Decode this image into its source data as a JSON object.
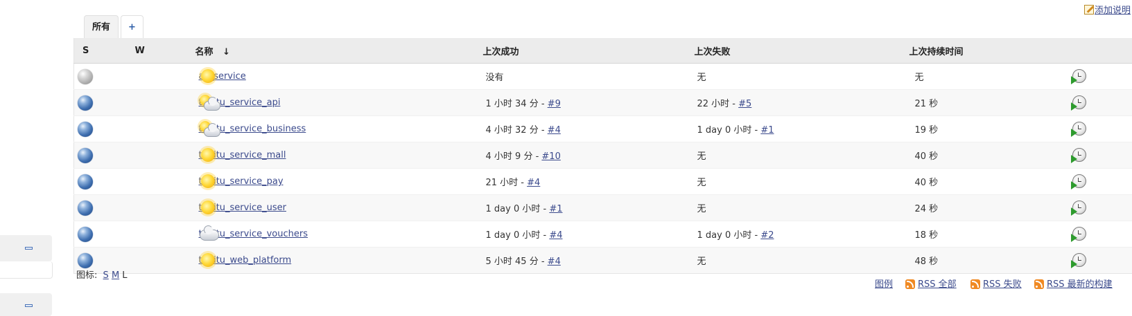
{
  "header": {
    "add_description": "添加说明"
  },
  "tabs": [
    {
      "label": "所有",
      "active": true
    },
    {
      "label": "+",
      "active": false
    }
  ],
  "table": {
    "columns": {
      "status": "S",
      "weather": "W",
      "name": "名称",
      "sort_indicator": "↓",
      "last_success": "上次成功",
      "last_failure": "上次失败",
      "last_duration": "上次持续时间"
    },
    "rows": [
      {
        "status_icon": "grey-ball-icon",
        "weather_icon": "sunny-icon",
        "name": "all_service",
        "success_text": "没有",
        "success_build": "",
        "failure_text": "无",
        "failure_build": "",
        "duration": "无"
      },
      {
        "status_icon": "blue-ball-icon",
        "weather_icon": "partly-cloudy-icon",
        "name": "tubitu_service_api",
        "success_text": "1 小时 34 分 - ",
        "success_build": "#9",
        "failure_text": "22 小时 - ",
        "failure_build": "#5",
        "duration": "21 秒"
      },
      {
        "status_icon": "blue-ball-icon",
        "weather_icon": "partly-cloudy-icon",
        "name": "tubitu_service_business",
        "success_text": "4 小时 32 分 - ",
        "success_build": "#4",
        "failure_text": "1 day 0 小时 - ",
        "failure_build": "#1",
        "duration": "19 秒"
      },
      {
        "status_icon": "blue-ball-icon",
        "weather_icon": "sunny-icon",
        "name": "tubitu_service_mall",
        "success_text": "4 小时 9 分 - ",
        "success_build": "#10",
        "failure_text": "无",
        "failure_build": "",
        "duration": "40 秒"
      },
      {
        "status_icon": "blue-ball-icon",
        "weather_icon": "sunny-icon",
        "name": "tubitu_service_pay",
        "success_text": "21 小时 - ",
        "success_build": "#4",
        "failure_text": "无",
        "failure_build": "",
        "duration": "40 秒"
      },
      {
        "status_icon": "blue-ball-icon",
        "weather_icon": "sunny-icon",
        "name": "tubitu_service_user",
        "success_text": "1 day 0 小时 - ",
        "success_build": "#1",
        "failure_text": "无",
        "failure_build": "",
        "duration": "24 秒"
      },
      {
        "status_icon": "blue-ball-icon",
        "weather_icon": "cloudy-icon",
        "name": "tubitu_service_vouchers",
        "success_text": "1 day 0 小时 - ",
        "success_build": "#4",
        "failure_text": "1 day 0 小时 - ",
        "failure_build": "#2",
        "duration": "18 秒"
      },
      {
        "status_icon": "blue-ball-icon",
        "weather_icon": "sunny-icon",
        "name": "tubitu_web_platform",
        "success_text": "5 小时 45 分 - ",
        "success_build": "#4",
        "failure_text": "无",
        "failure_build": "",
        "duration": "48 秒"
      }
    ]
  },
  "icon_size": {
    "label": "图标:",
    "options": [
      "S",
      "M",
      "L"
    ],
    "current": "L"
  },
  "footer": {
    "legend": "图例",
    "rss_all": "RSS 全部",
    "rss_failures": "RSS 失败",
    "rss_latest": "RSS 最新的构建"
  },
  "colors": {
    "link": "#3b4a8c",
    "header_bg": "#ececec",
    "stripe_bg": "#f8f8f8",
    "rss_orange": "#f08a24"
  }
}
